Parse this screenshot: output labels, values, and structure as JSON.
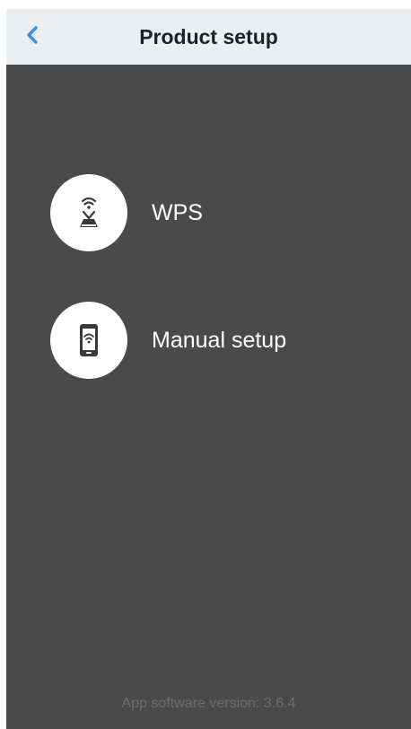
{
  "header": {
    "title": "Product setup",
    "back_icon": "chevron-left-icon",
    "accent_color": "#3d8fe3"
  },
  "options": [
    {
      "label": "WPS",
      "icon": "wps-router-icon"
    },
    {
      "label": "Manual setup",
      "icon": "phone-wifi-icon"
    }
  ],
  "footer": {
    "version_text": "App software version: 3.6.4"
  }
}
